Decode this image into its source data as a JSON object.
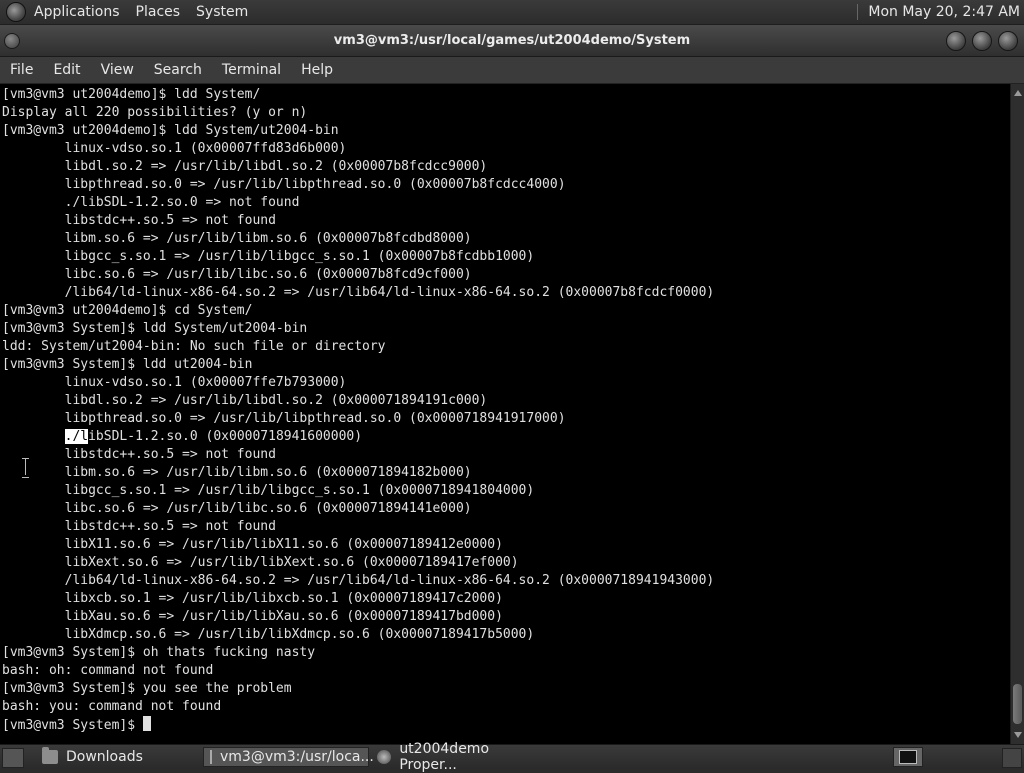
{
  "top_panel": {
    "menus": [
      "Applications",
      "Places",
      "System"
    ],
    "clock": "Mon May 20,  2:47 AM"
  },
  "window": {
    "title": "vm3@vm3:/usr/local/games/ut2004demo/System"
  },
  "menubar": [
    "File",
    "Edit",
    "View",
    "Search",
    "Terminal",
    "Help"
  ],
  "terminal": {
    "lines": [
      "[vm3@vm3 ut2004demo]$ ldd System/",
      "Display all 220 possibilities? (y or n)",
      "[vm3@vm3 ut2004demo]$ ldd System/ut2004-bin",
      "        linux-vdso.so.1 (0x00007ffd83d6b000)",
      "        libdl.so.2 => /usr/lib/libdl.so.2 (0x00007b8fcdcc9000)",
      "        libpthread.so.0 => /usr/lib/libpthread.so.0 (0x00007b8fcdcc4000)",
      "        ./libSDL-1.2.so.0 => not found",
      "        libstdc++.so.5 => not found",
      "        libm.so.6 => /usr/lib/libm.so.6 (0x00007b8fcdbd8000)",
      "        libgcc_s.so.1 => /usr/lib/libgcc_s.so.1 (0x00007b8fcdbb1000)",
      "        libc.so.6 => /usr/lib/libc.so.6 (0x00007b8fcd9cf000)",
      "        /lib64/ld-linux-x86-64.so.2 => /usr/lib64/ld-linux-x86-64.so.2 (0x00007b8fcdcf0000)",
      "[vm3@vm3 ut2004demo]$ cd System/",
      "[vm3@vm3 System]$ ldd System/ut2004-bin",
      "ldd: System/ut2004-bin: No such file or directory",
      "[vm3@vm3 System]$ ldd ut2004-bin",
      "        linux-vdso.so.1 (0x00007ffe7b793000)",
      "        libdl.so.2 => /usr/lib/libdl.so.2 (0x000071894191c000)",
      "        libpthread.so.0 => /usr/lib/libpthread.so.0 (0x0000718941917000)",
      "        ./libSDL-1.2.so.0 (0x0000718941600000)",
      "        libstdc++.so.5 => not found",
      "        libm.so.6 => /usr/lib/libm.so.6 (0x000071894182b000)",
      "        libgcc_s.so.1 => /usr/lib/libgcc_s.so.1 (0x0000718941804000)",
      "        libc.so.6 => /usr/lib/libc.so.6 (0x000071894141e000)",
      "        libstdc++.so.5 => not found",
      "        libX11.so.6 => /usr/lib/libX11.so.6 (0x00007189412e0000)",
      "        libXext.so.6 => /usr/lib/libXext.so.6 (0x00007189417ef000)",
      "        /lib64/ld-linux-x86-64.so.2 => /usr/lib64/ld-linux-x86-64.so.2 (0x0000718941943000)",
      "        libxcb.so.1 => /usr/lib/libxcb.so.1 (0x00007189417c2000)",
      "        libXau.so.6 => /usr/lib/libXau.so.6 (0x00007189417bd000)",
      "        libXdmcp.so.6 => /usr/lib/libXdmcp.so.6 (0x00007189417b5000)",
      "[vm3@vm3 System]$ oh thats fucking nasty",
      "bash: oh: command not found",
      "[vm3@vm3 System]$ you see the problem",
      "bash: you: command not found",
      "[vm3@vm3 System]$ "
    ],
    "selected_text": "./l",
    "selected_line_index": 19
  },
  "taskbar": {
    "items": [
      {
        "label": "Downloads",
        "icon": "folder-icon"
      },
      {
        "label": "vm3@vm3:/usr/loca...",
        "icon": "terminal-icon",
        "active": true
      },
      {
        "label": "ut2004demo Proper...",
        "icon": "ut-icon"
      }
    ]
  },
  "colors": {
    "terminal_bg": "#000000",
    "terminal_fg": "#e0e0e0",
    "panel_bg": "#2f2f2f"
  }
}
